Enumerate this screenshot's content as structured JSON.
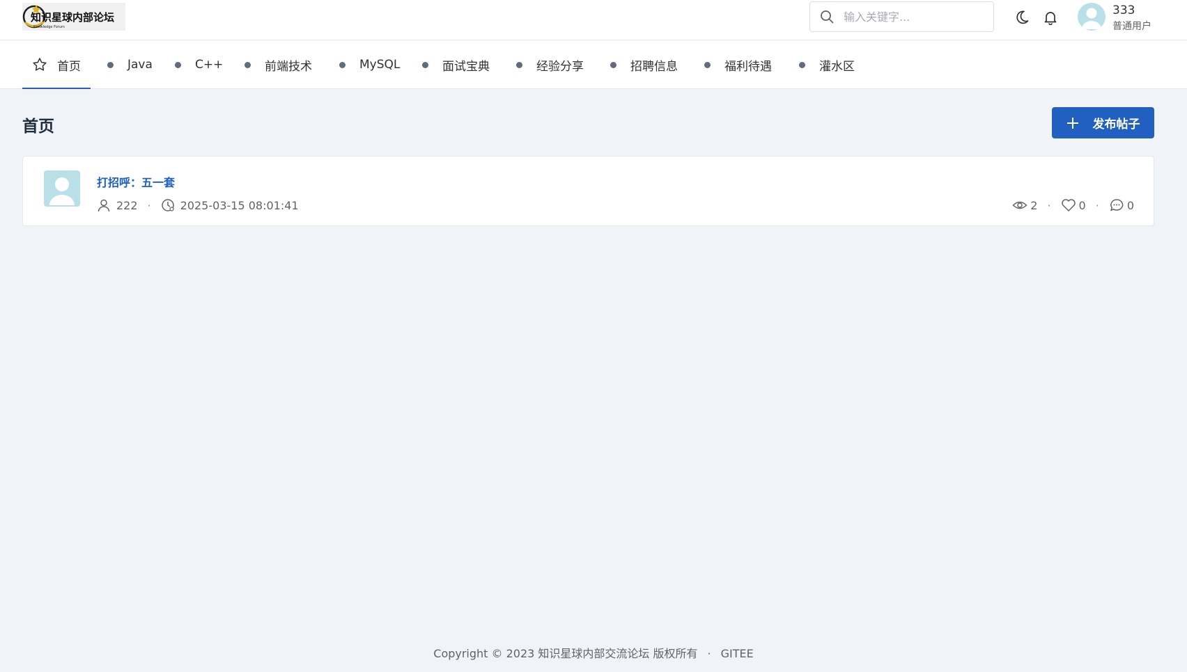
{
  "header": {
    "logo_text": "知识星球内部论坛",
    "logo_subtext": "Knowledge Forum",
    "search": {
      "placeholder": "输入关键字..."
    },
    "icons": [
      "search-icon",
      "moon-icon",
      "bell-icon"
    ],
    "user": {
      "name": "333",
      "role": "普通用户"
    }
  },
  "nav": {
    "items": [
      {
        "label": "首页",
        "active": true,
        "icon": "star-icon"
      },
      {
        "label": "Java"
      },
      {
        "label": "C++"
      },
      {
        "label": "前端技术"
      },
      {
        "label": "MySQL"
      },
      {
        "label": "面试宝典"
      },
      {
        "label": "经验分享"
      },
      {
        "label": "招聘信息"
      },
      {
        "label": "福利待遇"
      },
      {
        "label": "灌水区"
      }
    ]
  },
  "main": {
    "title": "首页",
    "publish_label": "发布帖子",
    "posts": [
      {
        "title": "打招呼：五一套",
        "author": "222",
        "time": "2025-03-15 08:01:41",
        "views": "2",
        "likes": "0",
        "comments": "0"
      }
    ]
  },
  "footer": {
    "copyright": "Copyright © 2023 知识星球内部交流论坛 版权所有",
    "separator": "·",
    "link": "GITEE"
  },
  "colors": {
    "accent": "#2160c0",
    "link": "#1e5fbf",
    "background": "#f0f3f8",
    "nav_dot": "#606b7d",
    "avatar": "#b9dfe9"
  }
}
